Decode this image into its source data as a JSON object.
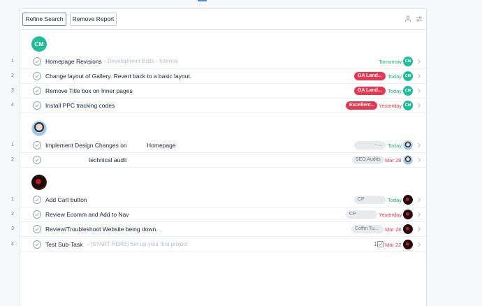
{
  "toolbar": {
    "refine_label": "Refine Search",
    "remove_label": "Remove Report"
  },
  "groups": [
    {
      "avatar_text": "CM",
      "tasks": [
        {
          "num": "1",
          "name": "Homepage Revisions",
          "project": "‹ Development Edits - Internal",
          "tag": "",
          "due": "Tomorrow",
          "due_color": "green",
          "assignee": "CM"
        },
        {
          "num": "2",
          "name": "Change layout of Gallery. Revert back to a basic layout.",
          "project": "",
          "tag": "GA Land...",
          "due": "Today",
          "due_color": "green",
          "assignee": "CM"
        },
        {
          "num": "3",
          "name": "Remove Title box on Inner pages",
          "project": "",
          "tag": "GA Land...",
          "due": "Today",
          "due_color": "green",
          "assignee": "CM"
        },
        {
          "num": "4",
          "name": "Install PPC tracking codes",
          "project": "",
          "tag": "Excellent...",
          "due": "Yesterday",
          "due_color": "red",
          "assignee": "CM"
        }
      ]
    },
    {
      "avatar_text": "",
      "tasks": [
        {
          "num": "1",
          "name": "Implement Design Changes on            Homepage",
          "project": "",
          "tag": "- ...",
          "due": "Today",
          "due_color": "green"
        },
        {
          "num": "2",
          "name": "technical audit",
          "project": "",
          "tag": "SEO Audits",
          "due": "Mar 28",
          "due_color": "red"
        }
      ]
    },
    {
      "avatar_text": "",
      "tasks": [
        {
          "num": "1",
          "name": "Add Cart button",
          "project": "",
          "tag": "CP            .",
          "due": "Today",
          "due_color": "green"
        },
        {
          "num": "2",
          "name": "Review Ecomm and Add to Nav",
          "project": "",
          "tag": "CP",
          "due": "Yesterday",
          "due_color": "red"
        },
        {
          "num": "3",
          "name": "Review/Troubleshoot Website being down.",
          "project": "",
          "tag": "Coffin Tu...",
          "due": "Mar 28",
          "due_color": "red"
        },
        {
          "num": "4",
          "name": "Test Sub-Task",
          "project": "‹ [START HERE] Set up your first project",
          "tag": "",
          "subtasks": "1",
          "due": "Mar 22",
          "due_color": "red"
        }
      ]
    }
  ],
  "colors": {
    "accent_green": "#1fbd98",
    "tag_red": "#e8384f",
    "due_green": "#1aaf7c",
    "due_red": "#e8384f"
  },
  "icons": {
    "toolbar_right": [
      "person-icon",
      "sliders-icon"
    ],
    "row": [
      "check-circle-icon",
      "chevron-right-icon"
    ]
  }
}
